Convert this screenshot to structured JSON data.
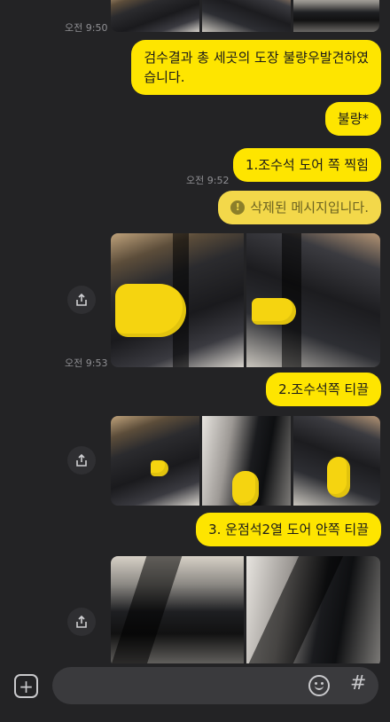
{
  "messages": [
    {
      "time": "오전 9:50"
    },
    {
      "text_line1": "검수결과 총 세곳의 도장 불량우발견하였",
      "text_line2": "습니다."
    },
    {
      "text": "불량*"
    },
    {
      "text": "1.조수석 도어 쪽 찍힘",
      "time": "오전 9:52"
    },
    {
      "text": "삭제된 메시지입니다."
    },
    {
      "time": "오전 9:53"
    },
    {
      "text": "2.조수석쪽 티끌"
    },
    {
      "text": "3. 운점석2열 도어 안쪽 티끌"
    }
  ],
  "composer": {
    "attach_icon": "plus-icon",
    "emoji_icon": "emoji-icon",
    "hashtag_icon": "hashtag-icon",
    "hashtag_glyph": "#",
    "input_value": ""
  },
  "colors": {
    "background": "#232325",
    "bubble": "#fee500",
    "deleted_bubble": "#f3d84a",
    "timestamp": "#8f8f93"
  }
}
